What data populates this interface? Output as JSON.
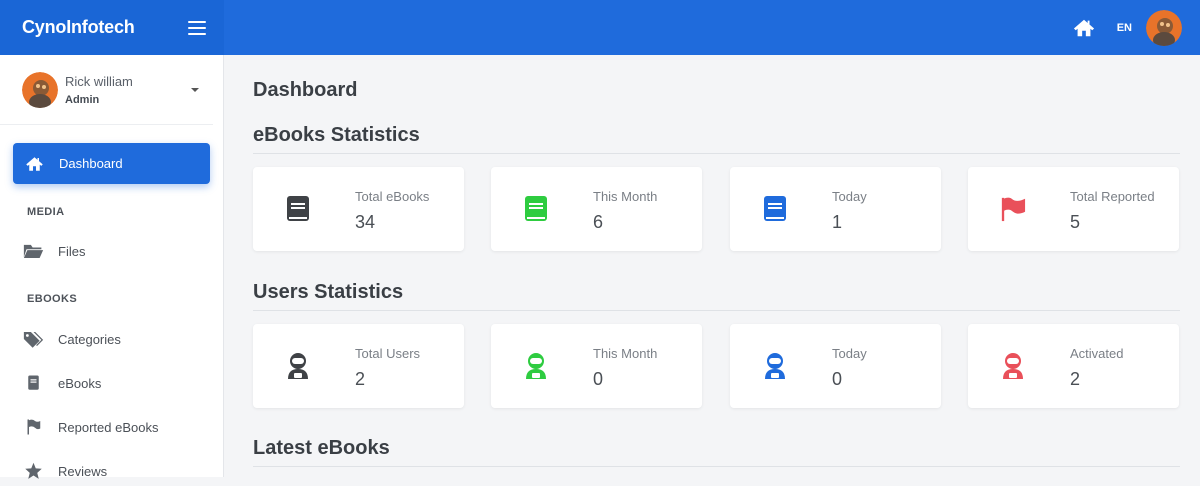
{
  "app": {
    "brand": "CynoInfotech",
    "language": "EN"
  },
  "user": {
    "name": "Rick william",
    "role": "Admin"
  },
  "sidebar": {
    "active": {
      "label": "Dashboard",
      "icon": "home-icon"
    },
    "sections": [
      {
        "title": "MEDIA",
        "items": [
          {
            "label": "Files",
            "icon": "folder-open-icon"
          }
        ]
      },
      {
        "title": "EBOOKS",
        "items": [
          {
            "label": "Categories",
            "icon": "tags-icon"
          },
          {
            "label": "eBooks",
            "icon": "book-icon"
          },
          {
            "label": "Reported eBooks",
            "icon": "flag-icon"
          },
          {
            "label": "Reviews",
            "icon": "star-icon"
          }
        ]
      }
    ]
  },
  "main": {
    "page_title": "Dashboard",
    "ebooks_section": "eBooks Statistics",
    "users_section": "Users Statistics",
    "latest_section": "Latest eBooks",
    "ebook_stats": [
      {
        "label": "Total eBooks",
        "value": "34",
        "icon": "book-icon",
        "color": "#3f4246"
      },
      {
        "label": "This Month",
        "value": "6",
        "icon": "book-icon",
        "color": "#2ecc40"
      },
      {
        "label": "Today",
        "value": "1",
        "icon": "book-icon",
        "color": "#1f6bdc"
      },
      {
        "label": "Total Reported",
        "value": "5",
        "icon": "flag-icon",
        "color": "#e9505a"
      }
    ],
    "user_stats": [
      {
        "label": "Total Users",
        "value": "2",
        "icon": "user-astronaut-icon",
        "color": "#3f4246"
      },
      {
        "label": "This Month",
        "value": "0",
        "icon": "user-astronaut-icon",
        "color": "#2ecc40"
      },
      {
        "label": "Today",
        "value": "0",
        "icon": "user-astronaut-icon",
        "color": "#1f6bdc"
      },
      {
        "label": "Activated",
        "value": "2",
        "icon": "user-astronaut-icon",
        "color": "#e9505a"
      }
    ]
  },
  "colors": {
    "primary": "#1f6bdc",
    "background": "#f4f5f7"
  }
}
